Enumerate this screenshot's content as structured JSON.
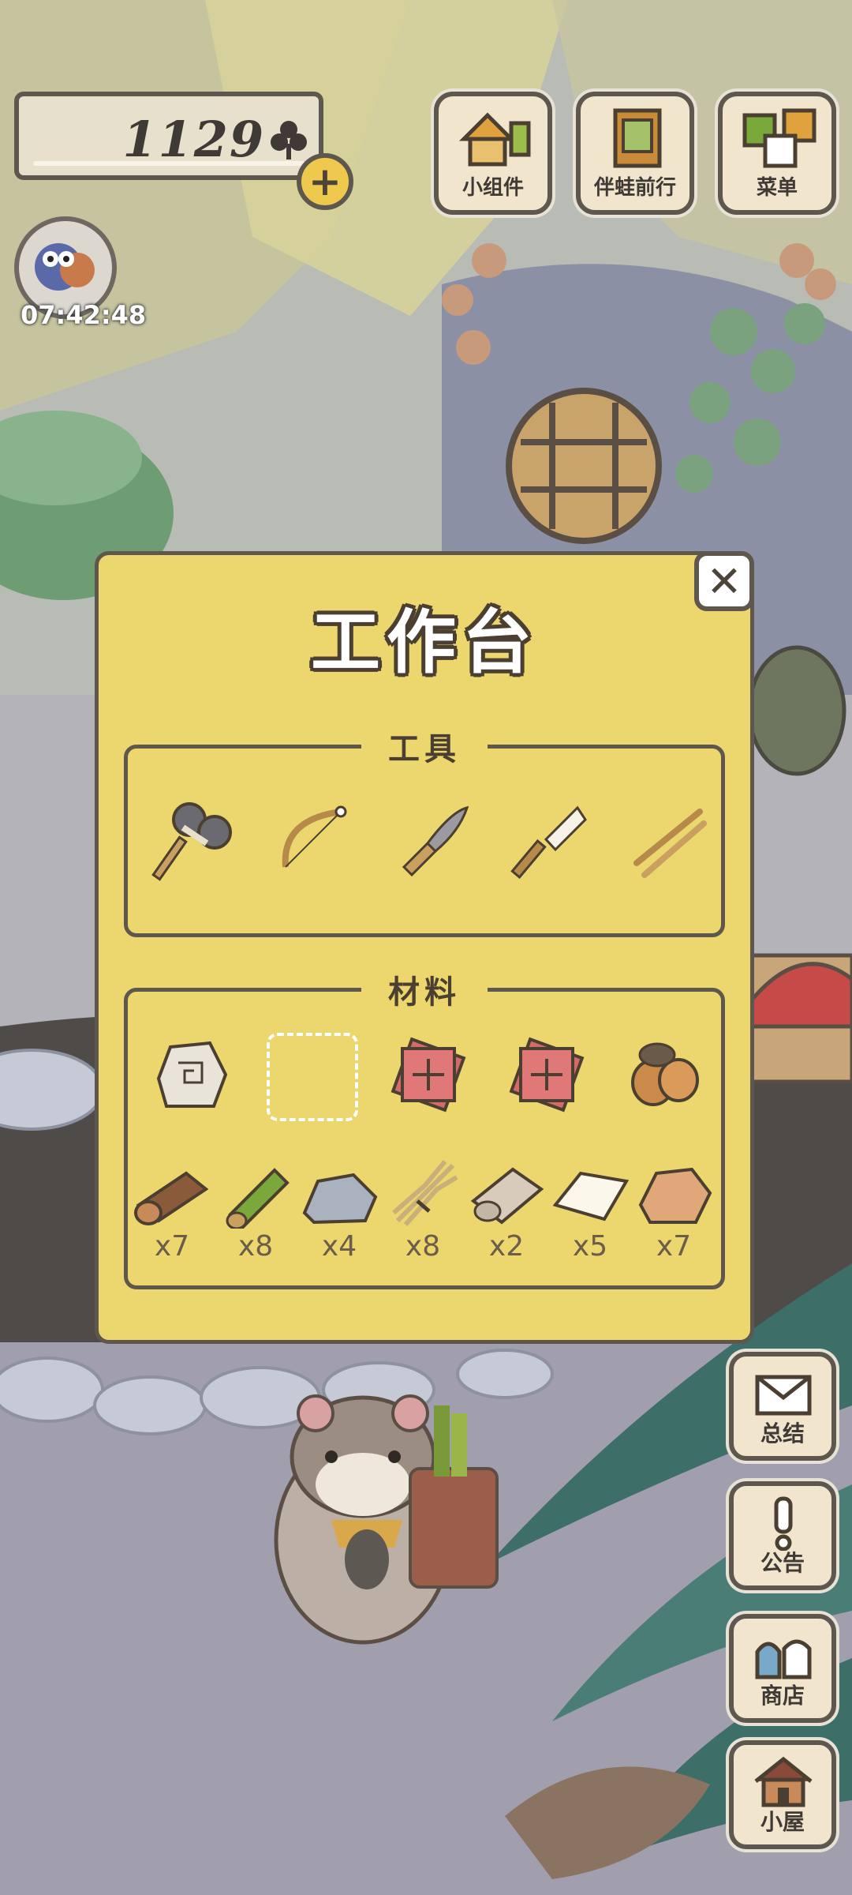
{
  "hud": {
    "clovers": "1129",
    "plus_symbol": "+",
    "timer": "07:42:48"
  },
  "top_buttons": [
    {
      "label": "小组件",
      "icon": "widget-icon"
    },
    {
      "label": "伴蛙前行",
      "icon": "journey-book-icon"
    },
    {
      "label": "菜单",
      "icon": "menu-cards-icon"
    }
  ],
  "workbench": {
    "title": "工作台",
    "close_symbol": "✕",
    "tools_label": "工具",
    "materials_label": "材料",
    "tools": [
      "stone-hammer-icon",
      "bow-drill-icon",
      "knife-icon",
      "brush-icon",
      "chopsticks-icon"
    ],
    "recipe_slots": [
      "stone-block-icon",
      "empty-slot",
      "talisman-icon",
      "talisman-icon",
      "chestnut-icon"
    ],
    "materials": [
      {
        "icon": "log-icon",
        "count": "x7"
      },
      {
        "icon": "bamboo-icon",
        "count": "x8"
      },
      {
        "icon": "stone-icon",
        "count": "x4"
      },
      {
        "icon": "straw-bundle-icon",
        "count": "x8"
      },
      {
        "icon": "cloth-roll-icon",
        "count": "x2"
      },
      {
        "icon": "paper-icon",
        "count": "x5"
      },
      {
        "icon": "clay-icon",
        "count": "x7"
      }
    ]
  },
  "side_buttons": [
    {
      "label": "总结",
      "icon": "envelope-icon"
    },
    {
      "label": "公告",
      "icon": "exclamation-icon"
    },
    {
      "label": "商店",
      "icon": "shop-bags-icon"
    },
    {
      "label": "小屋",
      "icon": "house-icon"
    }
  ],
  "colors": {
    "modal_bg": "#ecd66e",
    "outline": "#5d574e",
    "button_bg": "#f1e6cd"
  }
}
